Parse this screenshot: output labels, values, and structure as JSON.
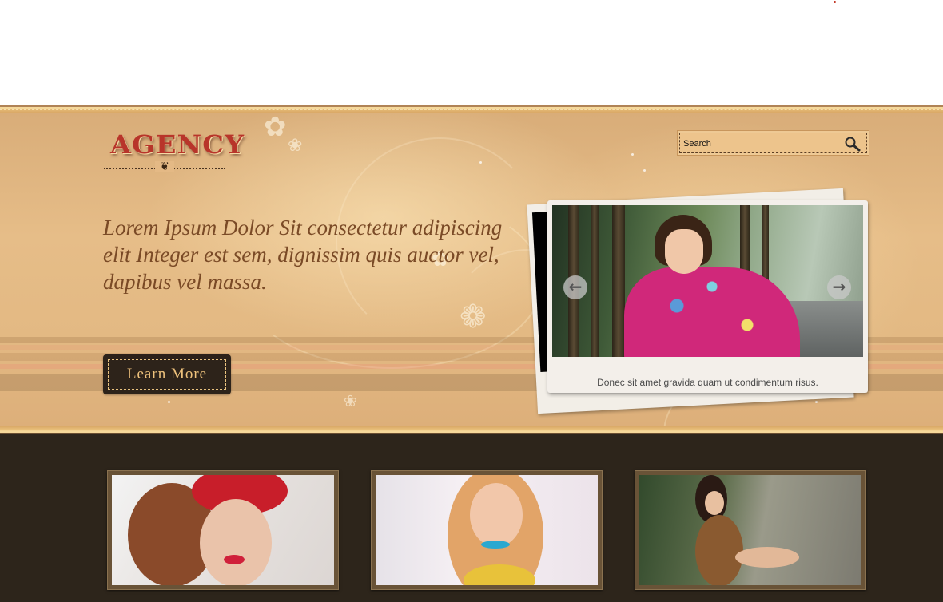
{
  "header": {
    "logo_text": "AGENCY",
    "ornament_glyph": "❦"
  },
  "search": {
    "placeholder": "Search",
    "icon": "search-icon"
  },
  "hero": {
    "headline": "Lorem Ipsum Dolor Sit consectetur adipiscing elit Integer est sem, dignissim quis auctor vel, dapibus vel massa.",
    "cta_label": "Learn More"
  },
  "slider": {
    "caption": "Donec sit amet gravida quam ut condimentum risus.",
    "prev_icon": "arrow-left-icon",
    "next_icon": "arrow-right-icon",
    "prev_glyph": "←",
    "next_glyph": "→"
  },
  "gallery": {
    "items": [
      {
        "subject": "woman-with-red-hat-and-veil"
      },
      {
        "subject": "woman-with-blonde-hair"
      },
      {
        "subject": "woman-sitting-on-road"
      }
    ]
  },
  "colors": {
    "hero_bg": "#e3b983",
    "dark_bg": "#2d251b",
    "logo_red": "#b8352a",
    "headline_brown": "#7a4a26",
    "cta_bg": "#2d231a",
    "cta_text": "#eec27c"
  }
}
